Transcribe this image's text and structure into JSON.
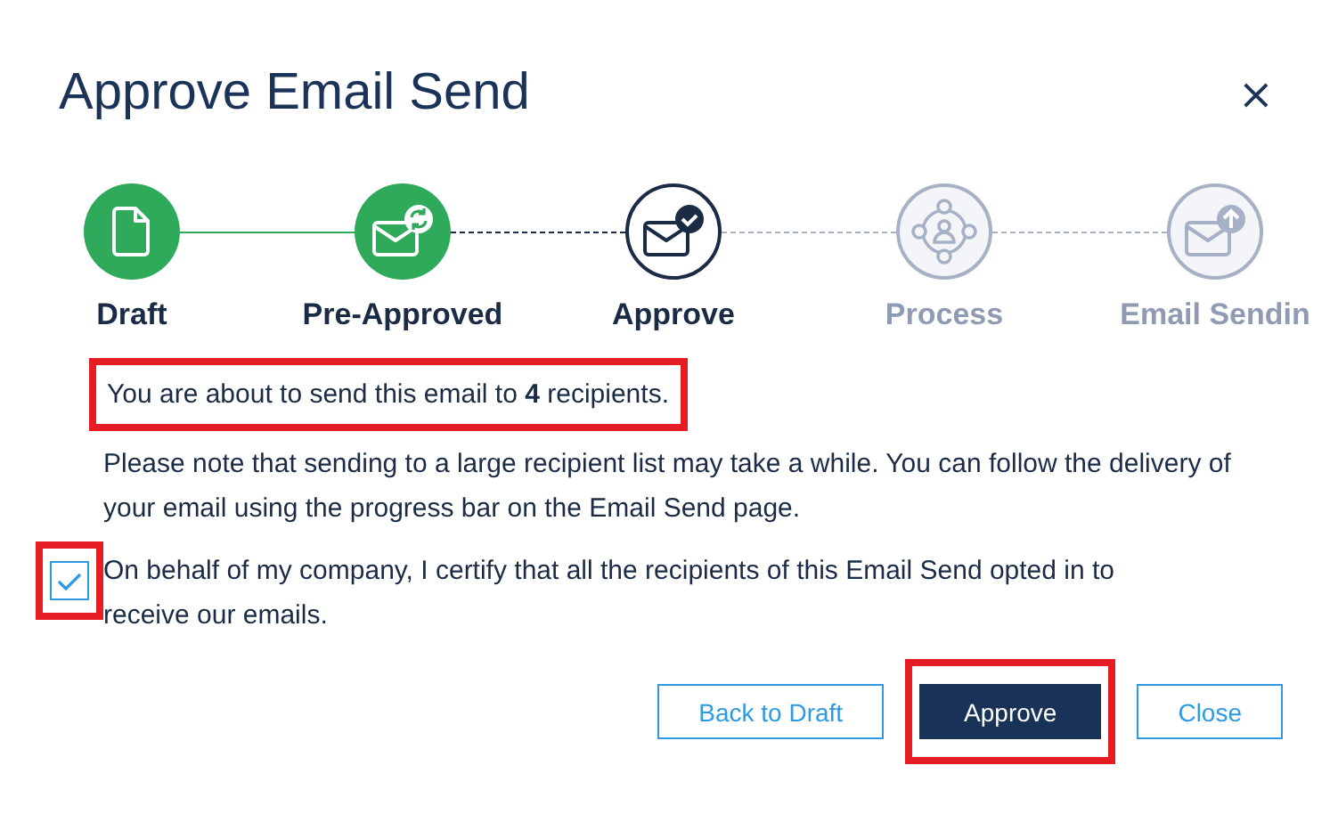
{
  "dialog": {
    "title": "Approve Email Send",
    "close_label": "×"
  },
  "steps": [
    {
      "label": "Draft",
      "kind": "done"
    },
    {
      "label": "Pre-Approved",
      "kind": "done"
    },
    {
      "label": "Approve",
      "kind": "current"
    },
    {
      "label": "Process",
      "kind": "pending"
    },
    {
      "label": "Email Sendin",
      "kind": "pending"
    }
  ],
  "intro": {
    "text": "You are about to send this email to **4** recipients.",
    "highlighted": true
  },
  "note": "Please note that sending to a large recipient list may take a while. You can follow the delivery of your email using the progress bar on the Email Send page.",
  "certify": {
    "label": "On behalf of my company, I certify that all the recipients of this Email Send opted in to receive our emails.",
    "checked": true,
    "highlighted": true
  },
  "buttons": [
    {
      "label": "Back to Draft",
      "kind": "secondary",
      "highlighted": false
    },
    {
      "label": "Approve",
      "kind": "primary",
      "highlighted": true
    },
    {
      "label": "Close",
      "kind": "secondary",
      "highlighted": false
    }
  ]
}
